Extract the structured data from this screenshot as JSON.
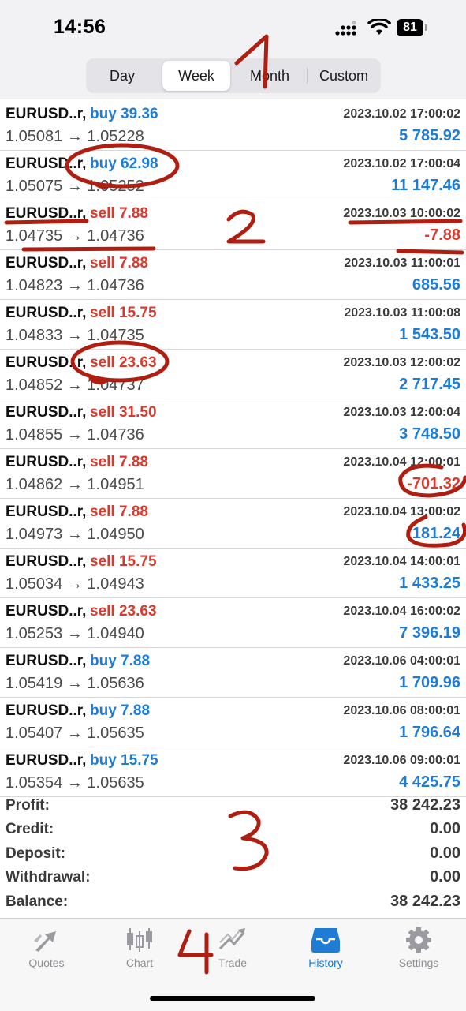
{
  "status": {
    "time": "14:56",
    "battery": "81"
  },
  "period_tabs": [
    {
      "label": "Day",
      "active": false
    },
    {
      "label": "Week",
      "active": true
    },
    {
      "label": "Month",
      "active": false
    },
    {
      "label": "Custom",
      "active": false
    }
  ],
  "trades": [
    {
      "symbol": "EURUSD..r,",
      "direction": "buy",
      "action": "buy 39.36",
      "datetime": "2023.10.02 17:00:02",
      "prices": "1.05081 → 1.05228",
      "profit": "5 785.92",
      "profit_sign": "pos"
    },
    {
      "symbol": "EURUSD..r,",
      "direction": "buy",
      "action": "buy 62.98",
      "datetime": "2023.10.02 17:00:04",
      "prices": "1.05075 → 1.05252",
      "profit": "11 147.46",
      "profit_sign": "pos"
    },
    {
      "symbol": "EURUSD..r,",
      "direction": "sell",
      "action": "sell 7.88",
      "datetime": "2023.10.03 10:00:02",
      "prices": "1.04735 → 1.04736",
      "profit": "-7.88",
      "profit_sign": "neg"
    },
    {
      "symbol": "EURUSD..r,",
      "direction": "sell",
      "action": "sell 7.88",
      "datetime": "2023.10.03 11:00:01",
      "prices": "1.04823 → 1.04736",
      "profit": "685.56",
      "profit_sign": "pos"
    },
    {
      "symbol": "EURUSD..r,",
      "direction": "sell",
      "action": "sell 15.75",
      "datetime": "2023.10.03 11:00:08",
      "prices": "1.04833 → 1.04735",
      "profit": "1 543.50",
      "profit_sign": "pos"
    },
    {
      "symbol": "EURUSD..r,",
      "direction": "sell",
      "action": "sell 23.63",
      "datetime": "2023.10.03 12:00:02",
      "prices": "1.04852 → 1.04737",
      "profit": "2 717.45",
      "profit_sign": "pos"
    },
    {
      "symbol": "EURUSD..r,",
      "direction": "sell",
      "action": "sell 31.50",
      "datetime": "2023.10.03 12:00:04",
      "prices": "1.04855 → 1.04736",
      "profit": "3 748.50",
      "profit_sign": "pos"
    },
    {
      "symbol": "EURUSD..r,",
      "direction": "sell",
      "action": "sell 7.88",
      "datetime": "2023.10.04 12:00:01",
      "prices": "1.04862 → 1.04951",
      "profit": "-701.32",
      "profit_sign": "neg"
    },
    {
      "symbol": "EURUSD..r,",
      "direction": "sell",
      "action": "sell 7.88",
      "datetime": "2023.10.04 13:00:02",
      "prices": "1.04973 → 1.04950",
      "profit": "181.24",
      "profit_sign": "pos"
    },
    {
      "symbol": "EURUSD..r,",
      "direction": "sell",
      "action": "sell 15.75",
      "datetime": "2023.10.04 14:00:01",
      "prices": "1.05034 → 1.04943",
      "profit": "1 433.25",
      "profit_sign": "pos"
    },
    {
      "symbol": "EURUSD..r,",
      "direction": "sell",
      "action": "sell 23.63",
      "datetime": "2023.10.04 16:00:02",
      "prices": "1.05253 → 1.04940",
      "profit": "7 396.19",
      "profit_sign": "pos"
    },
    {
      "symbol": "EURUSD..r,",
      "direction": "buy",
      "action": "buy 7.88",
      "datetime": "2023.10.06 04:00:01",
      "prices": "1.05419 → 1.05636",
      "profit": "1 709.96",
      "profit_sign": "pos"
    },
    {
      "symbol": "EURUSD..r,",
      "direction": "buy",
      "action": "buy 7.88",
      "datetime": "2023.10.06 08:00:01",
      "prices": "1.05407 → 1.05635",
      "profit": "1 796.64",
      "profit_sign": "pos"
    },
    {
      "symbol": "EURUSD..r,",
      "direction": "buy",
      "action": "buy 15.75",
      "datetime": "2023.10.06 09:00:01",
      "prices": "1.05354 → 1.05635",
      "profit": "4 425.75",
      "profit_sign": "pos"
    }
  ],
  "summary": [
    {
      "label": "Profit:",
      "value": "38 242.23"
    },
    {
      "label": "Credit:",
      "value": "0.00"
    },
    {
      "label": "Deposit:",
      "value": "0.00"
    },
    {
      "label": "Withdrawal:",
      "value": "0.00"
    },
    {
      "label": "Balance:",
      "value": "38 242.23"
    }
  ],
  "nav_tabs": [
    {
      "label": "Quotes",
      "icon": "quotes-arrows-icon",
      "active": false
    },
    {
      "label": "Chart",
      "icon": "candlestick-icon",
      "active": false
    },
    {
      "label": "Trade",
      "icon": "trend-arrow-icon",
      "active": false
    },
    {
      "label": "History",
      "icon": "inbox-tray-icon",
      "active": true
    },
    {
      "label": "Settings",
      "icon": "gear-icon",
      "active": false
    }
  ],
  "annotations": {
    "one": "1",
    "two": "2",
    "three": "3",
    "four": "4"
  },
  "colors": {
    "buy": "#1e7cd4",
    "sell": "#d83b2e",
    "active_tab": "#1e7cd4",
    "inactive_tab": "#8e8e93",
    "annotation": "#b01e12"
  }
}
